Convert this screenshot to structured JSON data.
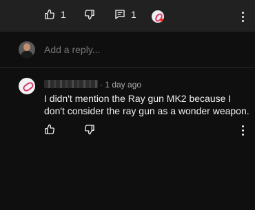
{
  "top_actions": {
    "like_count": "1",
    "reply_count": "1"
  },
  "reply_box": {
    "placeholder": "Add a reply..."
  },
  "comment": {
    "meta": "· 1 day ago",
    "text": "I didn't mention the Ray gun MK2 because I don't consider the ray gun as a wonder weapon."
  },
  "icons": {
    "like": "thumbs-up-icon",
    "dislike": "thumbs-down-icon",
    "reply": "comment-icon",
    "more": "more-vertical-icon",
    "heart": "heart-icon"
  },
  "colors": {
    "background": "#0f0f0f",
    "top_bar": "#212121",
    "text_primary": "#f1f1f1",
    "text_secondary": "#aaaaaa",
    "heart": "#ff2a2a"
  }
}
